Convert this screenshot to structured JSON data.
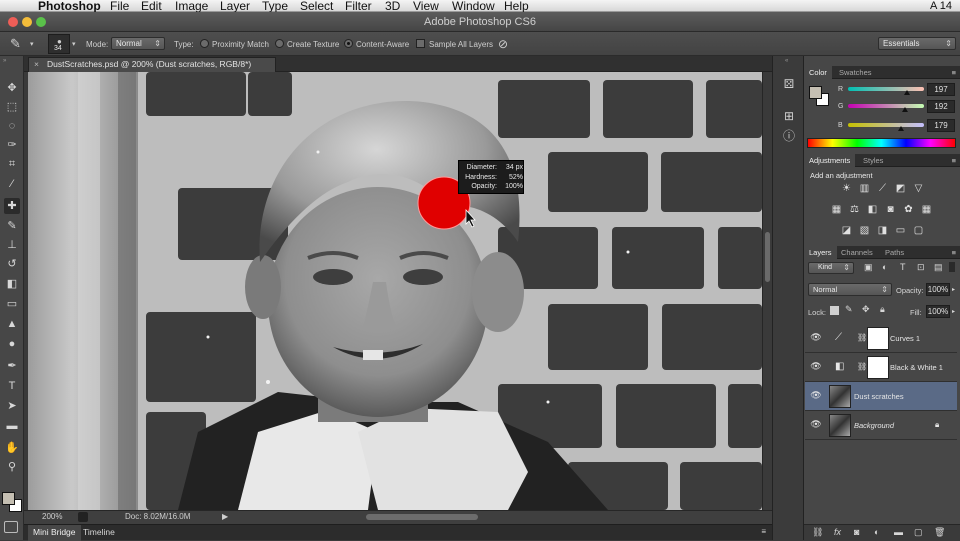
{
  "menubar": {
    "apple": "",
    "app_name": "Photoshop",
    "items": [
      "File",
      "Edit",
      "Image",
      "Layer",
      "Type",
      "Select",
      "Filter",
      "3D",
      "View",
      "Window",
      "Help"
    ],
    "right_text": "A 14"
  },
  "window": {
    "title": "Adobe Photoshop CS6"
  },
  "options": {
    "brush_size": "34",
    "mode_label": "Mode:",
    "mode_value": "Normal",
    "type_label": "Type:",
    "type_options": [
      "Proximity Match",
      "Create Texture",
      "Content-Aware"
    ],
    "type_selected": "Content-Aware",
    "sample_all_layers": "Sample All Layers",
    "workspace": "Essentials"
  },
  "document": {
    "tab_title": "DustScratches.psd @ 200% (Dust scratches, RGB/8*)",
    "close": "×"
  },
  "brush_tooltip": {
    "rows": [
      {
        "label": "Diameter:",
        "value": "34 px"
      },
      {
        "label": "Hardness:",
        "value": "52%"
      },
      {
        "label": "Opacity:",
        "value": "100%"
      }
    ]
  },
  "status": {
    "zoom": "200%",
    "doc": "Doc: 8.02M/16.0M"
  },
  "bottom_tabs": [
    "Mini Bridge",
    "Timeline"
  ],
  "color_panel": {
    "tabs": [
      "Color",
      "Swatches"
    ],
    "channels": [
      {
        "label": "R",
        "value": "197",
        "position": 0.77
      },
      {
        "label": "G",
        "value": "192",
        "position": 0.75
      },
      {
        "label": "B",
        "value": "179",
        "position": 0.7
      }
    ]
  },
  "adjustments_panel": {
    "tabs": [
      "Adjustments",
      "Styles"
    ],
    "heading": "Add an adjustment"
  },
  "layers_panel": {
    "tabs": [
      "Layers",
      "Channels",
      "Paths"
    ],
    "filter_kind": "Kind",
    "blend_mode": "Normal",
    "opacity_label": "Opacity:",
    "opacity_value": "100%",
    "lock_label": "Lock:",
    "fill_label": "Fill:",
    "fill_value": "100%",
    "layers": [
      {
        "name": "Curves 1",
        "selected": false
      },
      {
        "name": "Black & White 1",
        "selected": false
      },
      {
        "name": "Dust scratches",
        "selected": true
      },
      {
        "name": "Background",
        "selected": false
      }
    ]
  },
  "colors": {
    "selection": "#5a6a86",
    "brush_cursor": "#e00000"
  }
}
